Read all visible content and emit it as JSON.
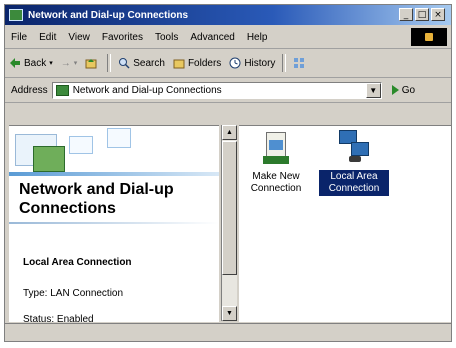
{
  "window": {
    "title": "Network and Dial-up Connections",
    "caption_buttons": [
      "_",
      "□",
      "×"
    ]
  },
  "menubar": {
    "items": [
      {
        "label": "File",
        "key": "F"
      },
      {
        "label": "Edit",
        "key": "E"
      },
      {
        "label": "View",
        "key": "V"
      },
      {
        "label": "Favorites",
        "key": "a"
      },
      {
        "label": "Tools",
        "key": "T"
      },
      {
        "label": "Advanced",
        "key": "d"
      },
      {
        "label": "Help",
        "key": "H"
      }
    ]
  },
  "toolbar": {
    "back_label": "Back",
    "forward_arrow": "→",
    "up_icon": "up-folder-icon",
    "search_label": "Search",
    "folders_label": "Folders",
    "history_label": "History"
  },
  "address": {
    "label": "Address",
    "value": "Network and Dial-up Connections",
    "go_label": "Go"
  },
  "left_panel": {
    "title": "Network and Dial-up Connections",
    "selected_name": "Local Area Connection",
    "type_text": "Type: LAN Connection",
    "status_text": "Status: Enabled"
  },
  "items": [
    {
      "label": "Make New Connection",
      "icon": "make-new-connection-icon",
      "selected": false
    },
    {
      "label": "Local Area Connection",
      "icon": "local-area-connection-icon",
      "selected": true
    }
  ],
  "colors": {
    "title_gradient_start": "#0a246a",
    "selection": "#0a246a",
    "chrome": "#d4d0c8"
  }
}
